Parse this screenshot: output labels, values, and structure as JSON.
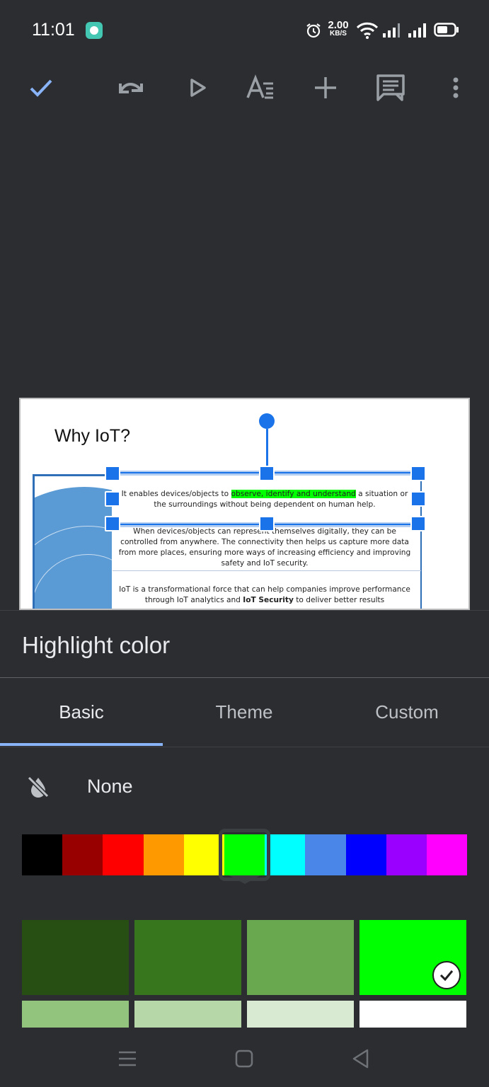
{
  "status_bar": {
    "time": "11:01",
    "net_speed_value": "2.00",
    "net_speed_unit": "KB/S",
    "icons": [
      "app-notification-icon",
      "alarm-icon",
      "wifi-icon",
      "signal-icon",
      "signal-icon",
      "battery-icon"
    ]
  },
  "toolbar": {
    "icons": [
      "check-icon",
      "undo-icon",
      "present-icon",
      "text-format-icon",
      "add-icon",
      "comment-icon",
      "more-vert-icon"
    ]
  },
  "slide": {
    "title": "Why IoT?",
    "para1_before": "It enables devices/objects to ",
    "para1_highlight": "observe, identify and understand",
    "para1_after": " a situation or the surroundings without being dependent on human help.",
    "para2": "When devices/objects can represent themselves digitally, they can be controlled from anywhere. The connectivity then helps us capture more data from more places, ensuring more ways of increasing efficiency and improving safety and IoT security.",
    "para3_before": "IoT is a transformational force that can help companies improve performance through IoT analytics and ",
    "para3_bold": "IoT Security",
    "para3_after": " to deliver better results",
    "highlight_color": "#00ff00"
  },
  "sheet": {
    "title": "Highlight color",
    "tabs": [
      "Basic",
      "Theme",
      "Custom"
    ],
    "active_tab": "Basic",
    "none_label": "None",
    "basic_colors": [
      "#000000",
      "#980000",
      "#ff0000",
      "#ff9900",
      "#ffff00",
      "#00ff00",
      "#00ffff",
      "#4a86e8",
      "#0000ff",
      "#9900ff",
      "#ff00ff"
    ],
    "selected_basic": "#00ff00",
    "shades_row1": [
      "#274e13",
      "#38761d",
      "#6aa84f",
      "#00ff00"
    ],
    "shades_row2": [
      "#93c47d",
      "#b6d7a8",
      "#d9ead3",
      "#ffffff"
    ],
    "selected_shade": "#00ff00"
  },
  "nav_bar": {
    "icons": [
      "recents-icon",
      "home-icon",
      "back-icon"
    ]
  }
}
